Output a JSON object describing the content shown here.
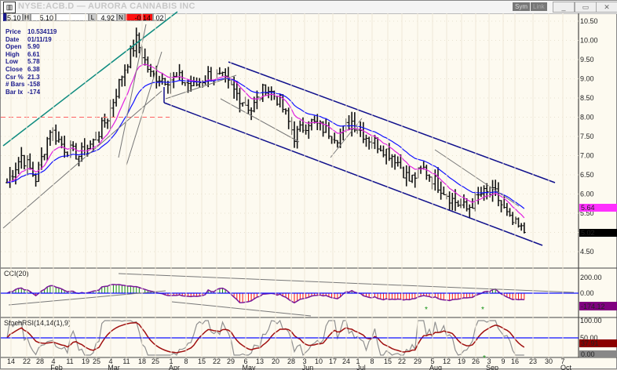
{
  "window": {
    "title": "NYSE:ACB.D — AURORA CANNABIS INC",
    "sym_button": "Sym",
    "link_button": "Link",
    "icon": "chart-app-icon"
  },
  "info_row": {
    "last": "5.10",
    "high_label": "H",
    "high": "5.10",
    "low_label": "L",
    "low": "4.92",
    "net_label": "N",
    "net": "-0.14",
    "pct": ".02"
  },
  "cursor_info": [
    {
      "k": "Price",
      "v": "10.534119"
    },
    {
      "k": "Date",
      "v": "01/11/19"
    },
    {
      "k": "Open",
      "v": "5.90"
    },
    {
      "k": "High",
      "v": "6.61"
    },
    {
      "k": "Low",
      "v": "5.78"
    },
    {
      "k": "Close",
      "v": "6.38"
    },
    {
      "k": "Csr %",
      "v": "21.3"
    },
    {
      "k": "# Bars",
      "v": "-158"
    },
    {
      "k": "Bar Ix",
      "v": "-174"
    }
  ],
  "colors": {
    "ema_fast": "#e020e0",
    "ema_slow": "#1010ff",
    "channel": "#10108c",
    "trend_teal": "#0f8c80",
    "cci_pos": "#109010",
    "cci_neg": "#ff1010",
    "cci_line": "#7a1a9a",
    "stoch_fast": "#909090",
    "stoch_slow": "#a01010"
  },
  "chart_data": [
    {
      "type": "ohlc",
      "panel": "price",
      "price_axis": [
        "10.50",
        "10.00",
        "9.50",
        "9.00",
        "8.50",
        "8.00",
        "7.50",
        "7.00",
        "6.50",
        "6.00",
        "5.50",
        "5.00",
        "4.50"
      ],
      "ylim": [
        4.2,
        10.8
      ],
      "weekly": {
        "weeks": [
          "Jan 14",
          "Jan 22",
          "Jan 28",
          "Feb 4",
          "Feb 11",
          "Feb 19",
          "Feb 25",
          "Mar 4",
          "Mar 11",
          "Mar 18",
          "Mar 25",
          "Apr 1",
          "Apr 8",
          "Apr 15",
          "Apr 22",
          "Apr 29",
          "May 6",
          "May 13",
          "May 20",
          "May 28",
          "Jun 3",
          "Jun 10",
          "Jun 17",
          "Jun 24",
          "Jul 1",
          "Jul 8",
          "Jul 15",
          "Jul 22",
          "Jul 29",
          "Aug 5",
          "Aug 12",
          "Aug 19",
          "Aug 26",
          "Sep 3",
          "Sep 9",
          "Sep 16",
          "Sep 23"
        ],
        "close": [
          6.3,
          7.0,
          6.4,
          7.7,
          7.2,
          7.0,
          7.35,
          8.0,
          9.1,
          10.0,
          9.1,
          9.0,
          9.0,
          8.8,
          9.1,
          9.0,
          8.6,
          8.2,
          8.8,
          8.4,
          7.5,
          7.9,
          7.7,
          7.5,
          7.9,
          7.5,
          7.25,
          6.95,
          6.35,
          6.65,
          6.25,
          5.85,
          5.6,
          6.0,
          6.0,
          5.3,
          5.0
        ]
      },
      "last_price_label": "5.02",
      "ema_label": "5.64",
      "reference_level": 8.0
    },
    {
      "type": "bar",
      "panel": "cci",
      "title": "CCI(20)",
      "axis": [
        "200.00",
        "0.00"
      ],
      "value_label": "-174.12"
    },
    {
      "type": "line",
      "panel": "stochrsi",
      "title": "StochRSI(14,14(1),9)",
      "axis": [
        "100.00",
        "50.00"
      ],
      "value_label": "37.91",
      "fast_label": "0.00"
    }
  ],
  "date_axis": {
    "days": [
      "14",
      "22",
      "28",
      "4",
      "11",
      "19",
      "25",
      "4",
      "11",
      "18",
      "25",
      "1",
      "8",
      "15",
      "22",
      "29",
      "6",
      "13",
      "20",
      "28",
      "3",
      "10",
      "17",
      "24",
      "1",
      "8",
      "15",
      "22",
      "29",
      "5",
      "12",
      "19",
      "26",
      "3",
      "9",
      "16",
      "23",
      "30",
      "7"
    ],
    "months": [
      "Feb",
      "Mar",
      "Apr",
      "May",
      "Jun",
      "Jul",
      "Aug",
      "Sep",
      "Oct"
    ]
  }
}
